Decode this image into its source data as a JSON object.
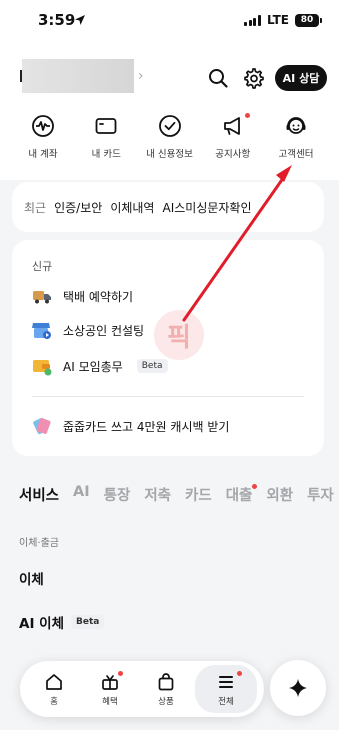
{
  "status_bar": {
    "time": "3:59",
    "network": "LTE",
    "battery": "80"
  },
  "header": {
    "ai_button_label": "AI 상담"
  },
  "quick_menu": [
    {
      "label": "내 계좌",
      "icon": "account-pulse-icon"
    },
    {
      "label": "내 카드",
      "icon": "card-icon"
    },
    {
      "label": "내 신용정보",
      "icon": "credit-check-icon"
    },
    {
      "label": "공지사항",
      "icon": "megaphone-icon"
    },
    {
      "label": "고객센터",
      "icon": "headset-agent-icon"
    }
  ],
  "recent": {
    "title": "최근",
    "items": [
      "인증/보안",
      "이체내역",
      "AI스미싱문자확인"
    ]
  },
  "new_section": {
    "title": "신규",
    "items": [
      {
        "label": "택배 예약하기",
        "icon": "delivery-truck-icon"
      },
      {
        "label": "소상공인 컨설팅",
        "icon": "store-icon"
      },
      {
        "label": "AI 모임총무",
        "icon": "wallet-icon",
        "badge": "Beta"
      }
    ],
    "promo": {
      "label": "줍줍카드 쓰고 4만원 캐시백 받기",
      "icon": "cards-icon"
    },
    "watermark": "픽"
  },
  "tabs": [
    "서비스",
    "AI",
    "통장",
    "저축",
    "카드",
    "대출",
    "외환",
    "투자"
  ],
  "service_section": {
    "caption": "이체·출금",
    "items": [
      {
        "label": "이체"
      },
      {
        "label": "AI 이체",
        "badge": "Beta"
      }
    ]
  },
  "bottom_nav": [
    {
      "label": "홈",
      "icon": "home-icon"
    },
    {
      "label": "혜택",
      "icon": "gift-icon"
    },
    {
      "label": "상품",
      "icon": "shopping-bag-icon"
    },
    {
      "label": "전체",
      "icon": "menu-icon"
    }
  ],
  "colors": {
    "accent": "#111111",
    "notification_dot": "#ef4444",
    "annotation_arrow": "#e11d2a"
  }
}
